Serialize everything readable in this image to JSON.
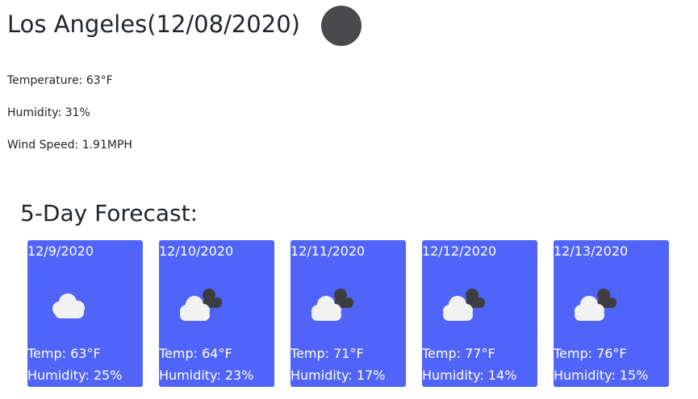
{
  "current": {
    "title": "Los Angeles(12/08/2020)",
    "icon": "moon-circle-icon",
    "temperature": "Temperature: 63°F",
    "humidity": "Humidity: 31%",
    "wind": "Wind Speed: 1.91MPH"
  },
  "forecast": {
    "heading": "5-Day Forecast:",
    "card_color": "#5064f9",
    "days": [
      {
        "date": "12/9/2020",
        "icon": "cloud-icon",
        "temp": "Temp: 63°F",
        "humidity": "Humidity: 25%"
      },
      {
        "date": "12/10/2020",
        "icon": "broken-clouds-icon",
        "temp": "Temp: 64°F",
        "humidity": "Humidity: 23%"
      },
      {
        "date": "12/11/2020",
        "icon": "broken-clouds-icon",
        "temp": "Temp: 71°F",
        "humidity": "Humidity: 17%"
      },
      {
        "date": "12/12/2020",
        "icon": "broken-clouds-icon",
        "temp": "Temp: 77°F",
        "humidity": "Humidity: 14%"
      },
      {
        "date": "12/13/2020",
        "icon": "broken-clouds-icon",
        "temp": "Temp: 76°F",
        "humidity": "Humidity: 15%"
      }
    ]
  }
}
